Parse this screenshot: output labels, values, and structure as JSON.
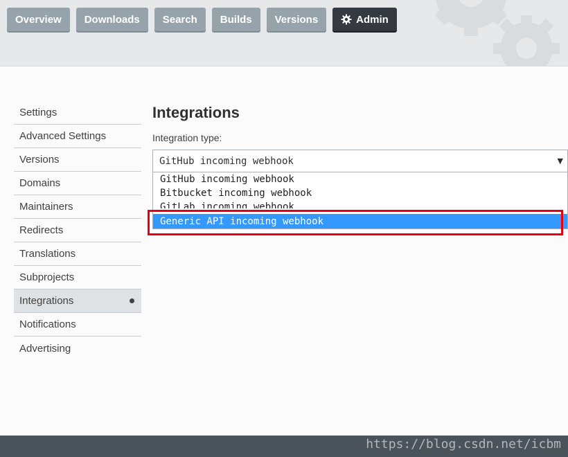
{
  "nav": {
    "items": [
      {
        "label": "Overview"
      },
      {
        "label": "Downloads"
      },
      {
        "label": "Search"
      },
      {
        "label": "Builds"
      },
      {
        "label": "Versions"
      }
    ],
    "admin_label": "Admin",
    "admin_icon": "gear-icon"
  },
  "sidebar": {
    "items": [
      {
        "label": "Settings"
      },
      {
        "label": "Advanced Settings"
      },
      {
        "label": "Versions"
      },
      {
        "label": "Domains"
      },
      {
        "label": "Maintainers"
      },
      {
        "label": "Redirects"
      },
      {
        "label": "Translations"
      },
      {
        "label": "Subprojects"
      },
      {
        "label": "Integrations",
        "active": true
      },
      {
        "label": "Notifications"
      },
      {
        "label": "Advertising"
      }
    ]
  },
  "main": {
    "title": "Integrations",
    "field_label": "Integration type:",
    "select_value": "GitHub incoming webhook",
    "options": [
      "GitHub incoming webhook",
      "Bitbucket incoming webhook",
      "GitLab incoming webhook",
      "Generic API incoming webhook"
    ],
    "highlighted_option": "Generic API incoming webhook"
  },
  "footer": {
    "watermark": "https://blog.csdn.net/icbm"
  },
  "colors": {
    "nav_button": "#97a3ab",
    "nav_active": "#343a40",
    "selected_option": "#3399ff",
    "annotation_box": "#e60012",
    "footer": "#4a535a"
  }
}
